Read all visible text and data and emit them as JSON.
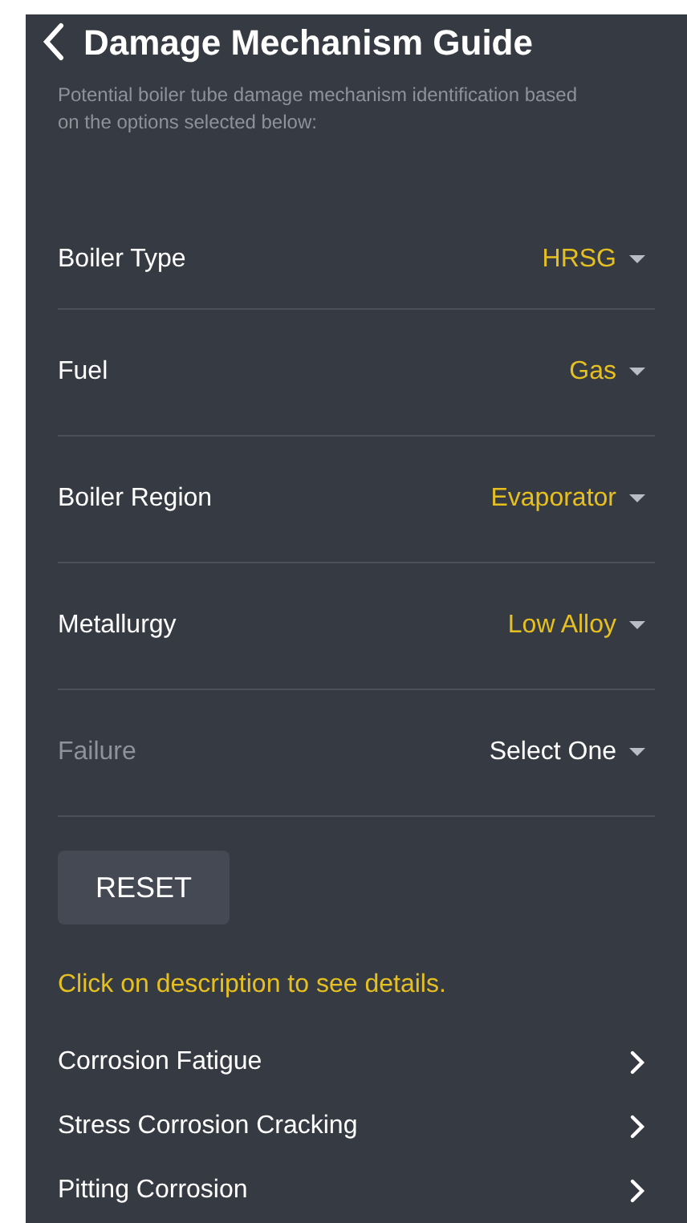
{
  "header": {
    "title": "Damage Mechanism Guide"
  },
  "description": "Potential boiler tube damage mechanism identification based on the options selected below:",
  "fields": [
    {
      "label": "Boiler Type",
      "value": "HRSG",
      "set": true
    },
    {
      "label": "Fuel",
      "value": "Gas",
      "set": true
    },
    {
      "label": "Boiler Region",
      "value": "Evaporator",
      "set": true
    },
    {
      "label": "Metallurgy",
      "value": "Low Alloy",
      "set": true
    },
    {
      "label": "Failure",
      "value": "Select One",
      "set": false
    }
  ],
  "reset_button": "RESET",
  "hint": "Click on description to see details.",
  "mechanisms": [
    "Corrosion Fatigue",
    "Stress Corrosion Cracking",
    "Pitting Corrosion"
  ]
}
